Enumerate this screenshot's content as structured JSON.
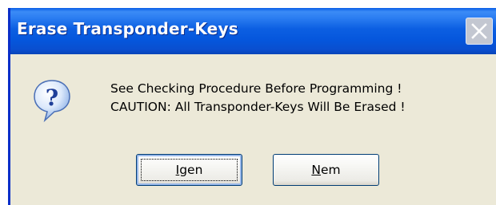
{
  "window": {
    "title": "Erase Transponder-Keys",
    "close_icon": "close-icon"
  },
  "dialog": {
    "icon": "question-icon",
    "message_line1": "See Checking Procedure Before Programming !",
    "message_line2": "CAUTION: All Transponder-Keys Will Be Erased !"
  },
  "buttons": {
    "yes": {
      "mnemonic": "I",
      "rest": "gen",
      "default": true
    },
    "no": {
      "mnemonic": "N",
      "rest": "em",
      "default": false
    }
  },
  "colors": {
    "titlebar": "#0a5ee6",
    "dialog_bg": "#ece9d8",
    "button_border": "#003c74"
  }
}
